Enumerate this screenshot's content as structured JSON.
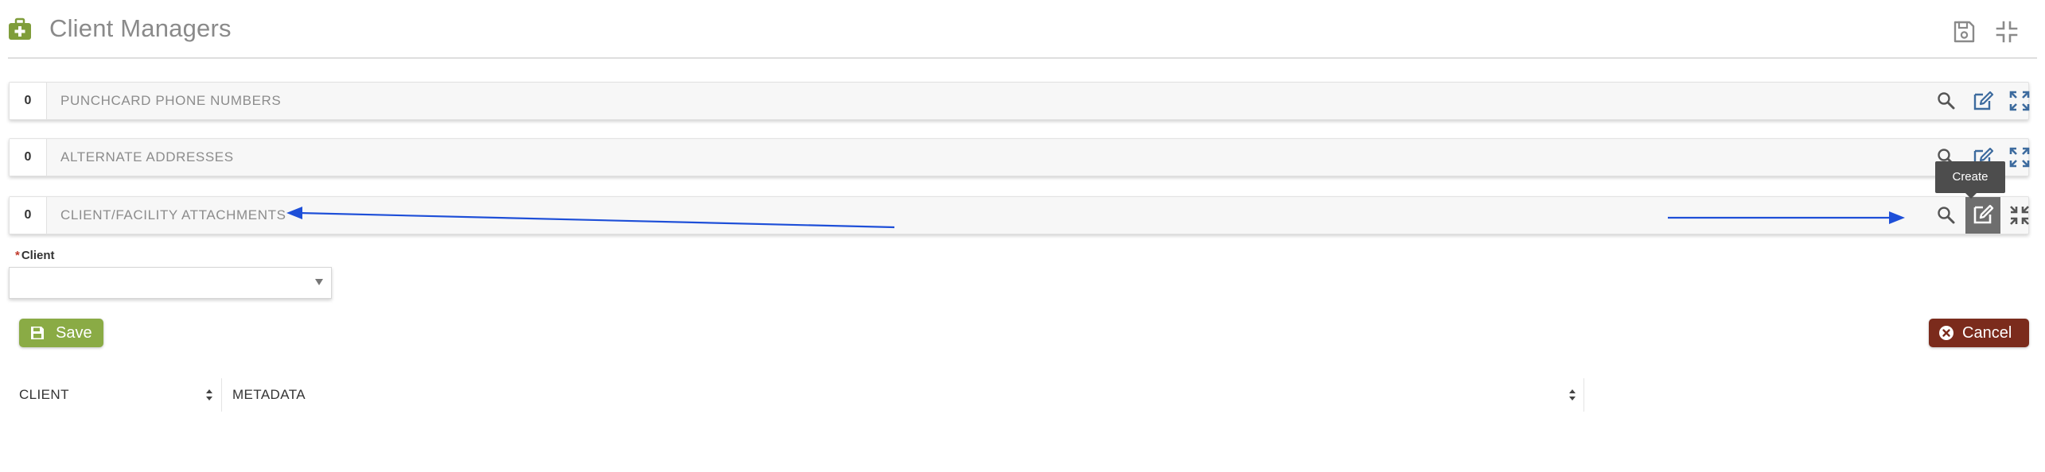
{
  "header": {
    "title": "Client Managers",
    "icon": "medical-kit-icon",
    "actions": [
      "save-icon",
      "compress-icon"
    ]
  },
  "panels": [
    {
      "count": "0",
      "title": "PUNCHCARD PHONE NUMBERS"
    },
    {
      "count": "0",
      "title": "ALTERNATE ADDRESSES"
    },
    {
      "count": "0",
      "title": "CLIENT/FACILITY ATTACHMENTS"
    }
  ],
  "tooltip": {
    "text": "Create"
  },
  "form": {
    "client_label": "Client",
    "required_mark": "*",
    "client_value": ""
  },
  "buttons": {
    "save_label": "Save",
    "cancel_label": "Cancel"
  },
  "table": {
    "columns": [
      "CLIENT",
      "METADATA"
    ]
  },
  "colors": {
    "accent_green": "#8aab45",
    "cancel_red": "#7b2b1c",
    "annotation_blue": "#1e4fd8",
    "active_button": "#6e6e6e"
  }
}
